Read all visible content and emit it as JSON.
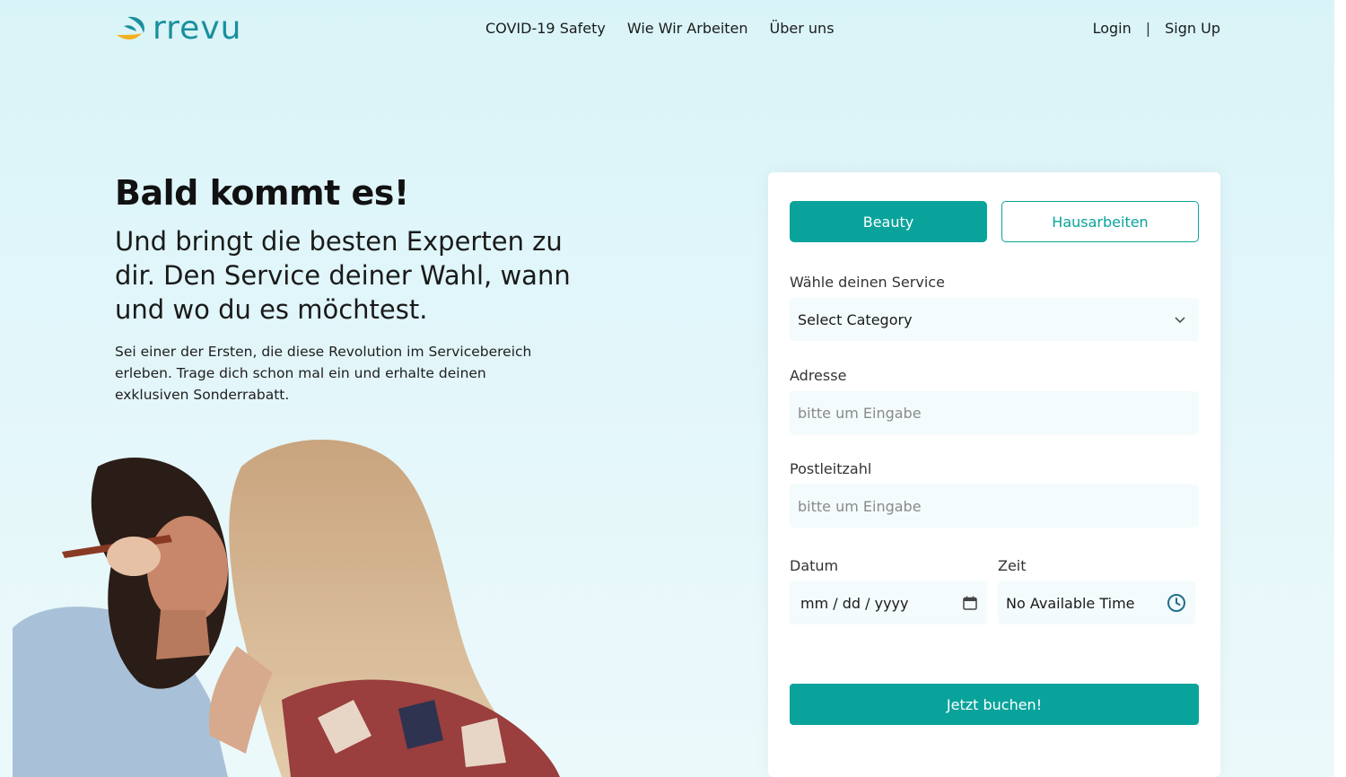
{
  "header": {
    "logo_text": "rrevu",
    "nav": [
      "COVID-19 Safety",
      "Wie Wir Arbeiten",
      "Über uns"
    ],
    "login": "Login",
    "separator": "|",
    "signup": "Sign Up"
  },
  "hero": {
    "title": "Bald kommt es!",
    "subtitle": "Und bringt die besten Experten zu dir. Den Service deiner Wahl, wann und wo du es möchtest.",
    "description": "Sei einer der Ersten, die diese Revolution im Servicebereich erleben. Trage dich schon mal ein und erhalte deinen exklusiven Sonderrabatt."
  },
  "form": {
    "tabs": [
      "Beauty",
      "Hausarbeiten"
    ],
    "service_label": "Wähle deinen Service",
    "service_value": "Select Category",
    "address_label": "Adresse",
    "address_placeholder": "bitte um Eingabe",
    "zip_label": "Postleitzahl",
    "zip_placeholder": "bitte um Eingabe",
    "date_label": "Datum",
    "date_value": "mm / dd / yyyy",
    "time_label": "Zeit",
    "time_value": "No Available Time",
    "submit_label": "Jetzt buchen!"
  },
  "colors": {
    "accent": "#0aa39c",
    "logo_teal": "#1a8f9c",
    "logo_yellow": "#f4b11f"
  }
}
